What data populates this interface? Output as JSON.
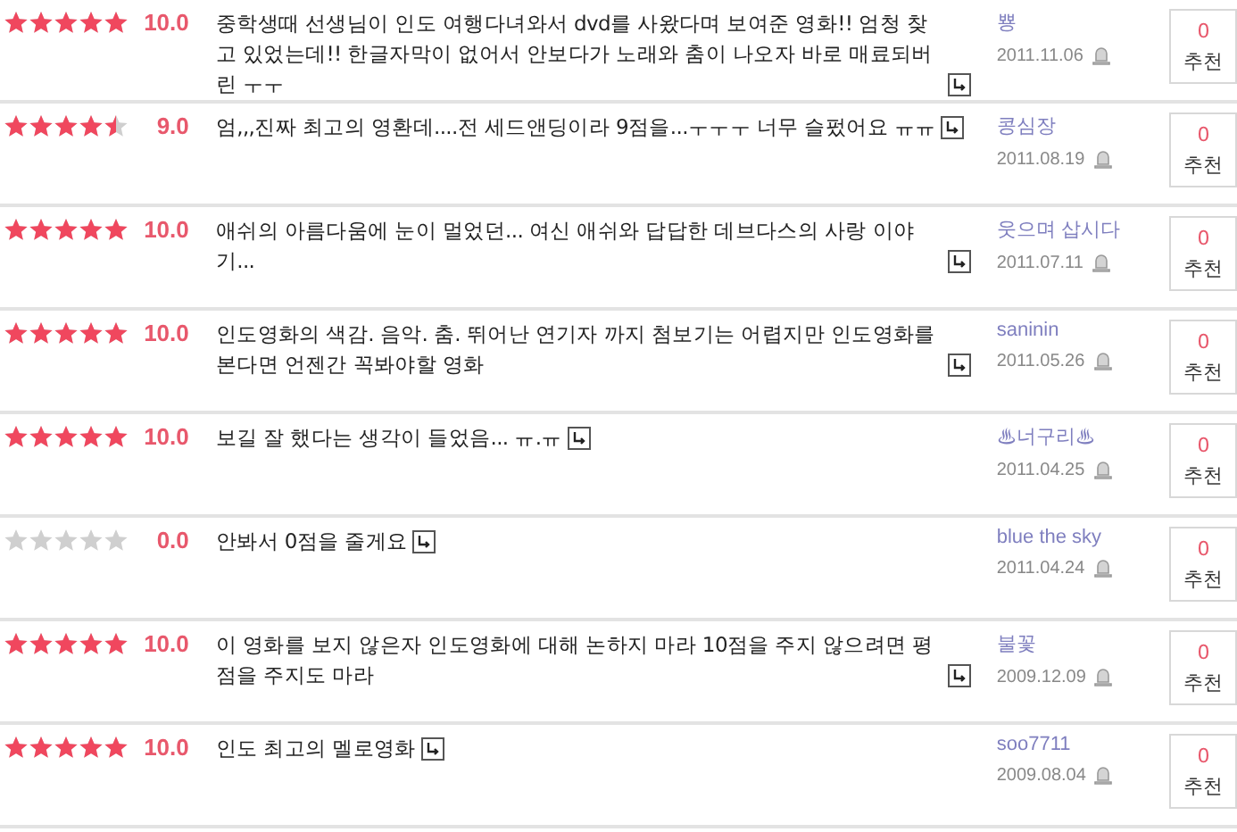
{
  "reviews": [
    {
      "stars": 5,
      "score": "10.0",
      "comment": "중학생때 선생님이 인도 여행다녀와서 dvd를 사왔다며 보여준 영화!! 엄청 찾고 있었는데!! 한글자막이 없어서 안보다가 노래와 춤이 나오자 바로 매료되버린 ㅜㅜ",
      "user": "뿅",
      "date": "2011.11.06",
      "votes": "0",
      "vote_label": "추천"
    },
    {
      "stars": 4.5,
      "score": "9.0",
      "comment": "엄,,,진짜 최고의 영환데....전 세드앤딩이라 9점을...ㅜㅜㅜ 너무 슬펐어요 ㅠㅠ",
      "user": "콩심장",
      "date": "2011.08.19",
      "votes": "0",
      "vote_label": "추천"
    },
    {
      "stars": 5,
      "score": "10.0",
      "comment": "애쉬의 아름다움에 눈이 멀었던... 여신 애쉬와 답답한 데브다스의 사랑 이야기...",
      "user": "웃으며 삽시다",
      "date": "2011.07.11",
      "votes": "0",
      "vote_label": "추천"
    },
    {
      "stars": 5,
      "score": "10.0",
      "comment": "인도영화의 색감. 음악. 춤. 뛰어난 연기자 까지 첨보기는 어렵지만 인도영화를 본다면 언젠간 꼭봐야할 영화",
      "user": "saninin",
      "date": "2011.05.26",
      "votes": "0",
      "vote_label": "추천"
    },
    {
      "stars": 5,
      "score": "10.0",
      "comment": "보길 잘 했다는 생각이 들었음... ㅠ.ㅠ",
      "user": "♨너구리♨",
      "date": "2011.04.25",
      "votes": "0",
      "vote_label": "추천"
    },
    {
      "stars": 0,
      "score": "0.0",
      "comment": "안봐서 0점을 줄게요",
      "user": "blue the sky",
      "date": "2011.04.24",
      "votes": "0",
      "vote_label": "추천"
    },
    {
      "stars": 5,
      "score": "10.0",
      "comment": "이 영화를 보지 않은자 인도영화에 대해 논하지 마라 10점을 주지 않으려면 평점을 주지도 마라",
      "user": "불꽃",
      "date": "2009.12.09",
      "votes": "0",
      "vote_label": "추천"
    },
    {
      "stars": 5,
      "score": "10.0",
      "comment": "인도 최고의 멜로영화",
      "user": "soo7711",
      "date": "2009.08.04",
      "votes": "0",
      "vote_label": "추천"
    }
  ]
}
